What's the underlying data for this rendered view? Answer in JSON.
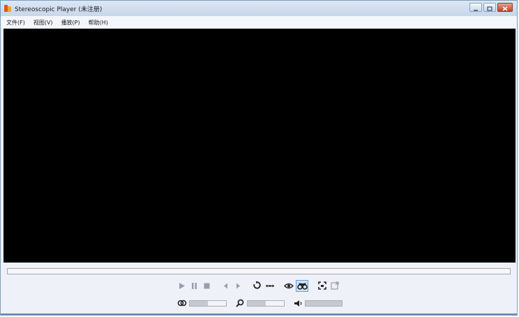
{
  "window": {
    "title": "Stereoscopic Player (未注册)"
  },
  "menu": {
    "items": [
      {
        "label": "文件(F)"
      },
      {
        "label": "视图(V)"
      },
      {
        "label": "播放(P)"
      },
      {
        "label": "帮助(H)"
      }
    ]
  },
  "icons": {
    "app": "stereo-player-logo-icon",
    "minimize": "minimize-icon",
    "maximize": "maximize-icon",
    "close": "close-icon",
    "play": "play-icon",
    "pause": "pause-icon",
    "stop": "stop-icon",
    "prev_frame": "step-back-icon",
    "next_frame": "step-forward-icon",
    "loop": "loop-icon",
    "swap": "swap-icon",
    "eye": "eye-icon",
    "binoculars": "binoculars-icon",
    "fullscreen": "fullscreen-icon",
    "window_mode": "window-mode-icon",
    "parallax": "parallax-icon",
    "zoom": "zoom-icon",
    "volume": "volume-icon"
  },
  "sliders": {
    "parallax": 0.0,
    "zoom": 0.0,
    "volume": 0.0
  },
  "colors": {
    "video_bg": "#000000",
    "active_toggle": "#cde3fb"
  }
}
